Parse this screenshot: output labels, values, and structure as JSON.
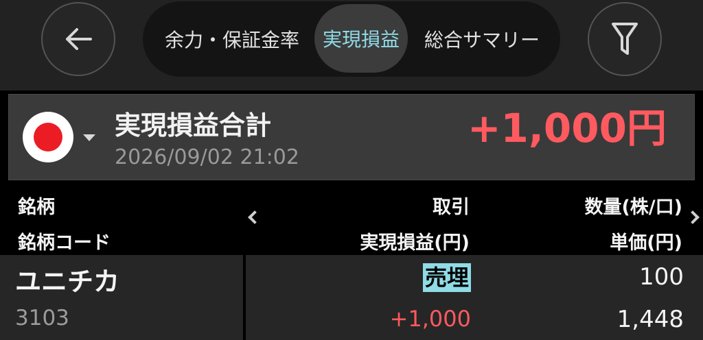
{
  "nav": {
    "back_icon": "arrow-left-icon",
    "filter_icon": "filter-icon",
    "tabs": [
      {
        "label": "余力・保証金率"
      },
      {
        "label": "実現損益"
      },
      {
        "label": "総合サマリー"
      }
    ],
    "active_tab": "実現損益"
  },
  "summary": {
    "market_flag": "japan-flag-icon",
    "title": "実現損益合計",
    "datetime": "2026/09/02 21:02",
    "total": "+1,000円"
  },
  "table": {
    "headers": {
      "name": "銘柄",
      "code": "銘柄コード",
      "trade": "取引",
      "realized_pl": "実現損益(円)",
      "quantity": "数量(株/口)",
      "unit_price": "単価(円)"
    },
    "rows": [
      {
        "name": "ユニチカ",
        "code": "3103",
        "trade": "売埋",
        "realized_pl": "+1,000",
        "quantity": "100",
        "unit_price": "1,448"
      }
    ]
  },
  "colors": {
    "accent": "#8fdbe6",
    "profit": "#ff5a5f",
    "background": "#000000",
    "panel": "#262626"
  }
}
